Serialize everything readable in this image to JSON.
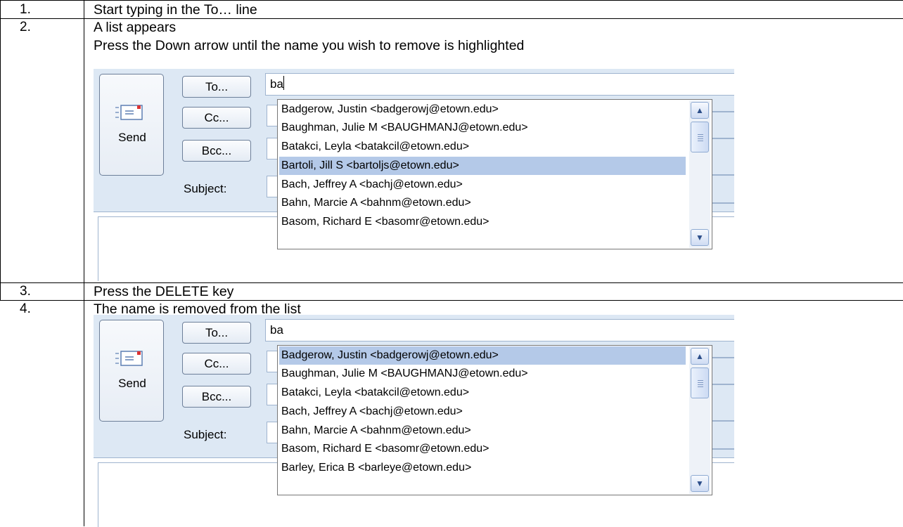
{
  "steps": [
    {
      "number": "1.",
      "lines": [
        "Start typing in the To… line"
      ]
    },
    {
      "number": "2.",
      "lines": [
        "A list appears",
        "Press the Down arrow until the name you wish to remove is highlighted"
      ]
    },
    {
      "number": "3.",
      "lines": [
        "Press the DELETE key"
      ]
    },
    {
      "number": "4.",
      "lines": [
        "The name is removed from the list"
      ]
    }
  ],
  "email_form": {
    "send_label": "Send",
    "to_label": "To...",
    "cc_label": "Cc...",
    "bcc_label": "Bcc...",
    "subject_label": "Subject:",
    "to_value": "ba"
  },
  "screenshot_before": {
    "suggestions": [
      {
        "text": "Badgerow, Justin  <badgerowj@etown.edu>",
        "selected": false
      },
      {
        "text": "Baughman, Julie M  <BAUGHMANJ@etown.edu>",
        "selected": false
      },
      {
        "text": "Batakci, Leyla   <batakcil@etown.edu>",
        "selected": false
      },
      {
        "text": "Bartoli, Jill S  <bartoljs@etown.edu>",
        "selected": true
      },
      {
        "text": "Bach, Jeffrey A  <bachj@etown.edu>",
        "selected": false
      },
      {
        "text": "Bahn, Marcie A  <bahnm@etown.edu>",
        "selected": false
      },
      {
        "text": "Basom, Richard E  <basomr@etown.edu>",
        "selected": false
      }
    ]
  },
  "screenshot_after": {
    "suggestions": [
      {
        "text": "Badgerow, Justin  <badgerowj@etown.edu>",
        "selected": true
      },
      {
        "text": "Baughman, Julie M  <BAUGHMANJ@etown.edu>",
        "selected": false
      },
      {
        "text": "Batakci, Leyla   <batakcil@etown.edu>",
        "selected": false
      },
      {
        "text": "Bach, Jeffrey A  <bachj@etown.edu>",
        "selected": false
      },
      {
        "text": "Bahn, Marcie A  <bahnm@etown.edu>",
        "selected": false
      },
      {
        "text": "Basom, Richard E  <basomr@etown.edu>",
        "selected": false
      },
      {
        "text": "Barley, Erica B  <barleye@etown.edu>",
        "selected": false
      }
    ]
  },
  "colors": {
    "header_bg": "#dde8f4",
    "selection": "#b4c9e8",
    "border": "#9fb4cf"
  },
  "icons": [
    "envelope-send-icon",
    "scroll-up-icon",
    "scroll-down-icon"
  ]
}
